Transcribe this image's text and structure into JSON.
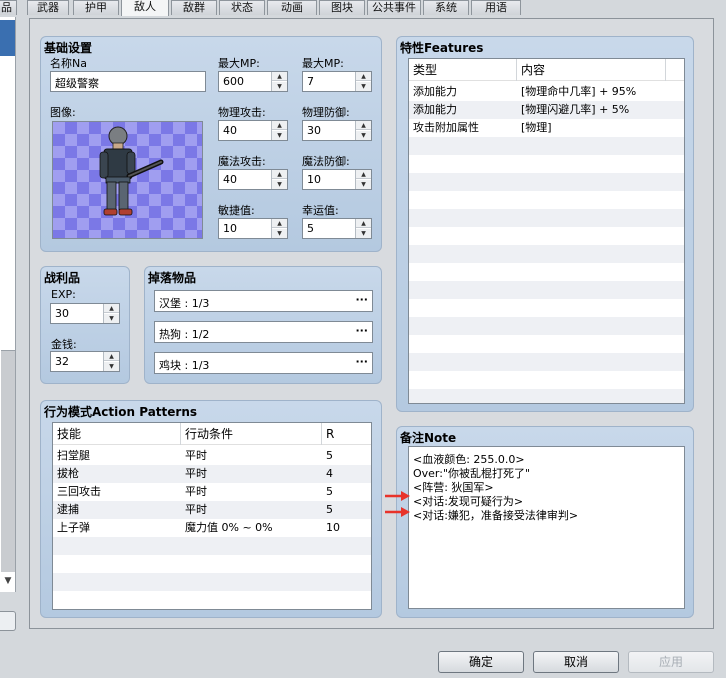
{
  "tabs": [
    {
      "label": "品",
      "active": false
    },
    {
      "label": "武器",
      "active": false
    },
    {
      "label": "护甲",
      "active": false
    },
    {
      "label": "敌人",
      "active": true
    },
    {
      "label": "敌群",
      "active": false
    },
    {
      "label": "状态",
      "active": false
    },
    {
      "label": "动画",
      "active": false
    },
    {
      "label": "图块",
      "active": false
    },
    {
      "label": "公共事件",
      "active": false
    },
    {
      "label": "系统",
      "active": false
    },
    {
      "label": "用语",
      "active": false
    }
  ],
  "basic": {
    "title": "基础设置",
    "name_label": "名称Na",
    "name_value": "超级警察",
    "image_label": "图像:",
    "maxmp1_label": "最大MP:",
    "maxmp1_value": "600",
    "maxmp2_label": "最大MP:",
    "maxmp2_value": "7",
    "patk_label": "物理攻击:",
    "patk_value": "40",
    "pdef_label": "物理防御:",
    "pdef_value": "30",
    "matk_label": "魔法攻击:",
    "matk_value": "40",
    "mdef_label": "魔法防御:",
    "mdef_value": "10",
    "agi_label": "敏捷值:",
    "agi_value": "10",
    "luck_label": "幸运值:",
    "luck_value": "5"
  },
  "rewards": {
    "title": "战利品",
    "exp_label": "EXP:",
    "exp_value": "30",
    "gold_label": "金钱:",
    "gold_value": "32"
  },
  "drops": {
    "title": "掉落物品",
    "items": [
      "汉堡 : 1/3",
      "热狗 : 1/2",
      "鸡块 : 1/3"
    ]
  },
  "actions": {
    "title": "行为模式Action Patterns",
    "headers": [
      "技能",
      "行动条件",
      "R"
    ],
    "rows": [
      [
        "扫堂腿",
        "平时",
        "5"
      ],
      [
        "拔枪",
        "平时",
        "4"
      ],
      [
        "三回攻击",
        "平时",
        "5"
      ],
      [
        "逮捕",
        "平时",
        "5"
      ],
      [
        "上子弹",
        "魔力值 0% ~ 0%",
        "10"
      ]
    ]
  },
  "features": {
    "title": "特性Features",
    "headers": [
      "类型",
      "内容"
    ],
    "rows": [
      [
        "添加能力",
        "[物理命中几率] + 95%"
      ],
      [
        "添加能力",
        "[物理闪避几率] + 5%"
      ],
      [
        "攻击附加属性",
        "[物理]"
      ]
    ]
  },
  "note": {
    "title": "备注Note",
    "lines": [
      "<血液颜色: 255.0.0>",
      "Over:\"你被乱棍打死了\"",
      "<阵营: 狄国军>",
      "<对话:发现可疑行为>",
      "<对话:嫌犯，准备接受法律审判>"
    ]
  },
  "buttons": {
    "ok": "确定",
    "cancel": "取消",
    "apply": "应用"
  },
  "colors": {
    "group_bg": "#c0d2e6",
    "arrow": "#e8332a",
    "selection": "#3a6fb0"
  }
}
